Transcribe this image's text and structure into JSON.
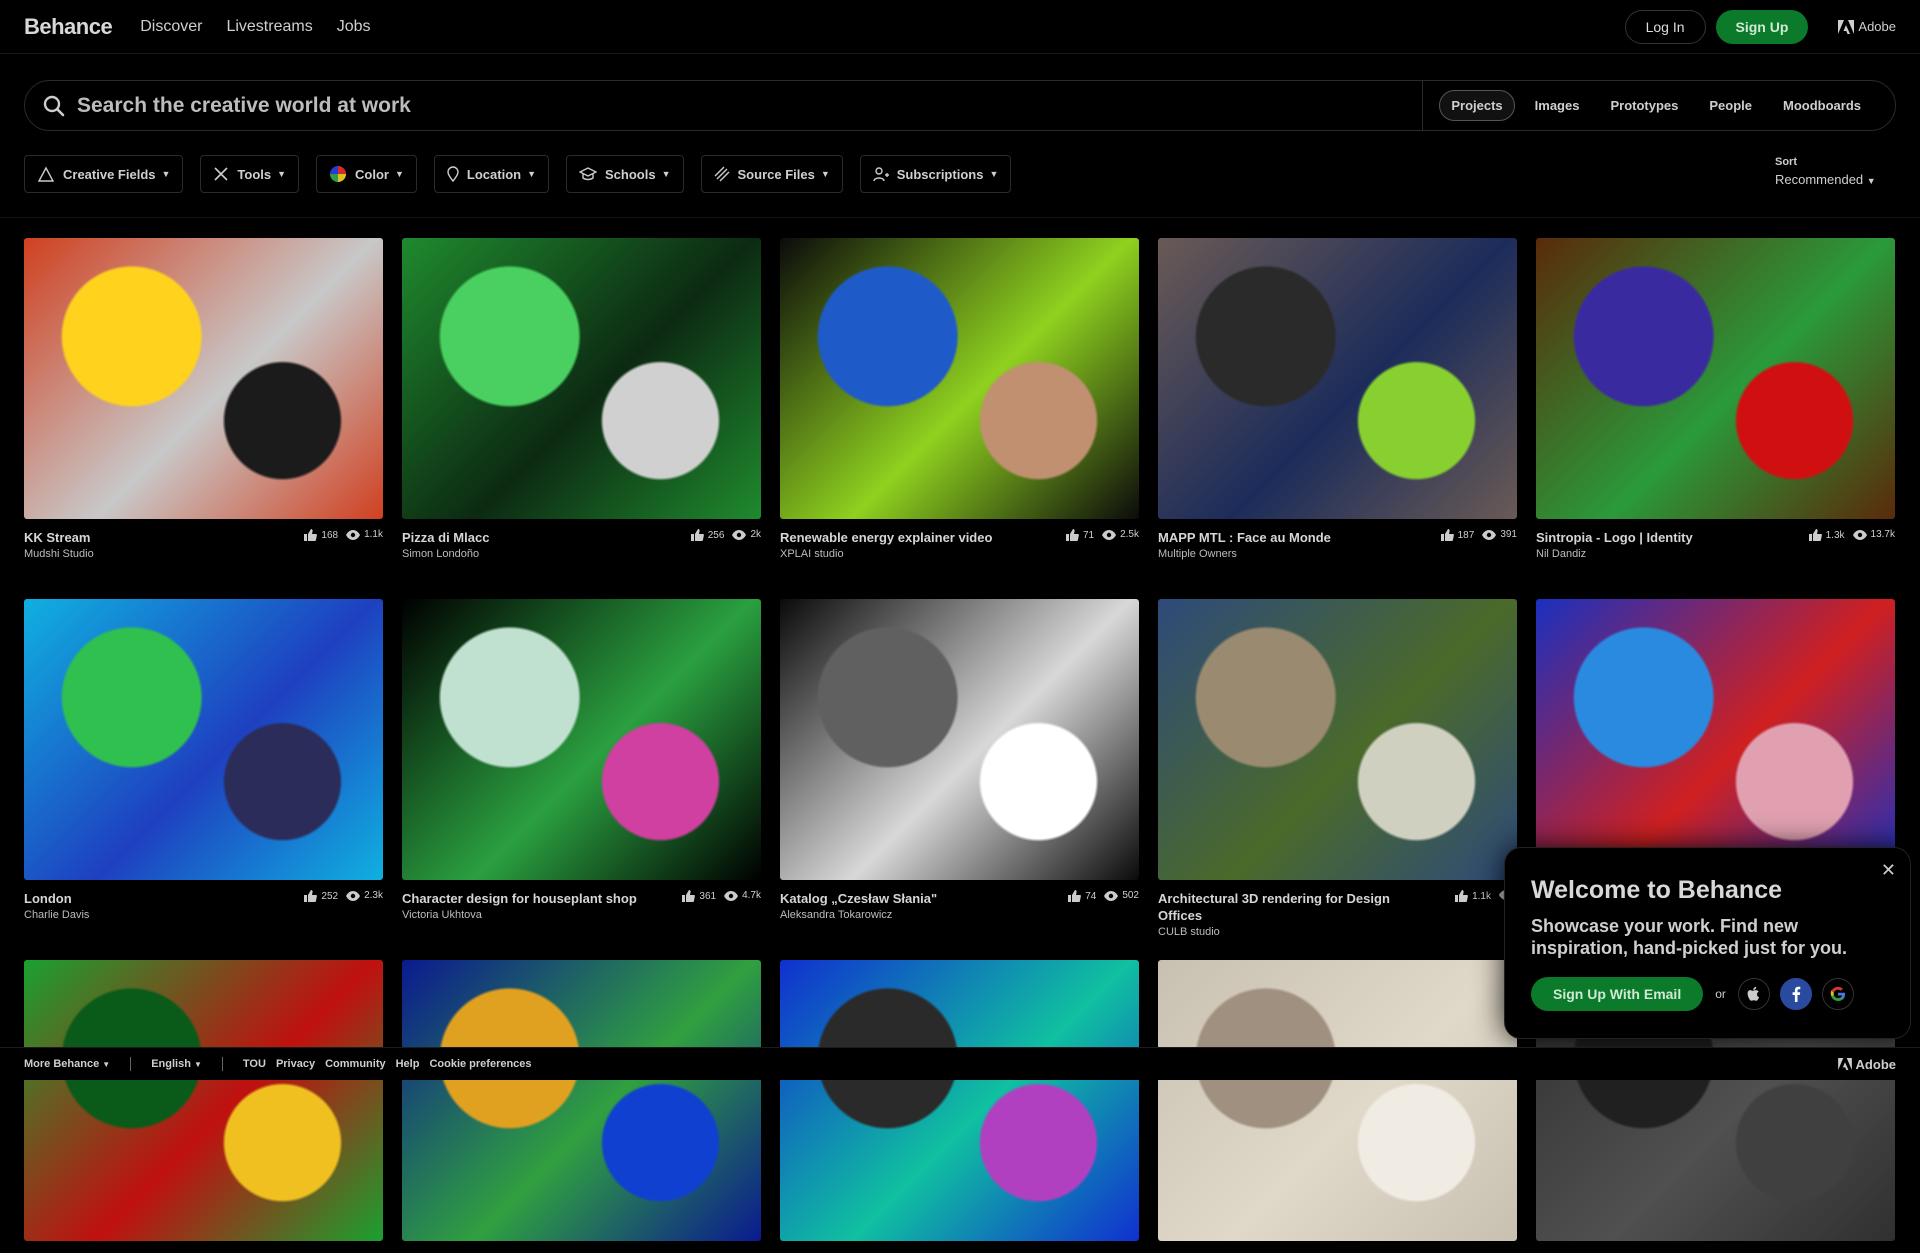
{
  "nav": {
    "logo": "Behance",
    "links": [
      "Discover",
      "Livestreams",
      "Jobs"
    ],
    "login": "Log In",
    "signup": "Sign Up",
    "adobe": "Adobe"
  },
  "search": {
    "placeholder": "Search the creative world at work",
    "tabs": [
      "Projects",
      "Images",
      "Prototypes",
      "People",
      "Moodboards"
    ],
    "active_tab": "Projects"
  },
  "filters": [
    "Creative Fields",
    "Tools",
    "Color",
    "Location",
    "Schools",
    "Source Files",
    "Subscriptions"
  ],
  "sort": {
    "label": "Sort",
    "value": "Recommended"
  },
  "projects": [
    {
      "title": "KK Stream",
      "owner": "Mudshi Studio",
      "likes": "168",
      "views": "1.1k",
      "colors": [
        "#d04020",
        "#c8c8c8",
        "#ffd21e",
        "#1b1b1b"
      ]
    },
    {
      "title": "Pizza di Mlacc",
      "owner": "Simon Londoño",
      "likes": "256",
      "views": "2k",
      "colors": [
        "#1f8a2e",
        "#0c2a12",
        "#49d060",
        "#d0d0d0"
      ]
    },
    {
      "title": "Renewable energy explainer video",
      "owner": "XPLAI studio",
      "likes": "71",
      "views": "2.5k",
      "colors": [
        "#0b0b0b",
        "#8fd11f",
        "#1e5bc8",
        "#c09070"
      ]
    },
    {
      "title": "MAPP MTL : Face au Monde",
      "owner": "Multiple Owners",
      "likes": "187",
      "views": "391",
      "colors": [
        "#6a5a55",
        "#1c2c5a",
        "#2a2a2a",
        "#88d030"
      ]
    },
    {
      "title": "Sintropia - Logo | Identity",
      "owner": "Nil Dandiz",
      "likes": "1.3k",
      "views": "13.7k",
      "colors": [
        "#5a2a0a",
        "#2a9a3a",
        "#3a2aa0",
        "#d01010"
      ]
    },
    {
      "title": "London",
      "owner": "Charlie Davis",
      "likes": "252",
      "views": "2.3k",
      "colors": [
        "#10b0e0",
        "#1e40c0",
        "#30c050",
        "#2c2c5a"
      ]
    },
    {
      "title": "Character design for houseplant shop",
      "owner": "Victoria Ukhtova",
      "likes": "361",
      "views": "4.7k",
      "colors": [
        "#000000",
        "#2aa040",
        "#c0e0d0",
        "#d040a0"
      ]
    },
    {
      "title": "Katalog „Czesław Słania\"",
      "owner": "Aleksandra Tokarowicz",
      "likes": "74",
      "views": "502",
      "colors": [
        "#0a0a0a",
        "#d8d8d8",
        "#606060",
        "#ffffff"
      ]
    },
    {
      "title": "Architectural 3D rendering for Design Offices",
      "owner": "CULB studio",
      "likes": "1.1k",
      "views": "",
      "colors": [
        "#2e4a7a",
        "#4a6a2a",
        "#9a8a70",
        "#d0d0c0"
      ]
    },
    {
      "title": "",
      "owner": "",
      "likes": "",
      "views": "",
      "colors": [
        "#1a30c0",
        "#d02020",
        "#2a8ae0",
        "#e0a0b0"
      ]
    },
    {
      "title": "",
      "owner": "",
      "likes": "",
      "views": "",
      "colors": [
        "#1aa030",
        "#c01010",
        "#0a5a1a",
        "#f0c020"
      ]
    },
    {
      "title": "",
      "owner": "",
      "likes": "",
      "views": "",
      "colors": [
        "#0a1a90",
        "#30a040",
        "#e0a020",
        "#1040d0"
      ]
    },
    {
      "title": "",
      "owner": "",
      "likes": "",
      "views": "",
      "colors": [
        "#1030d0",
        "#10c0a0",
        "#2a2a2a",
        "#b040c0"
      ]
    },
    {
      "title": "",
      "owner": "",
      "likes": "",
      "views": "",
      "colors": [
        "#c8c0b0",
        "#e0d8c8",
        "#a09080",
        "#f0ece4"
      ]
    },
    {
      "title": "",
      "owner": "",
      "likes": "",
      "views": "",
      "colors": [
        "#303030",
        "#505050",
        "#202020",
        "#404040"
      ]
    }
  ],
  "welcome": {
    "title": "Welcome to Behance",
    "text": "Showcase your work. Find new inspiration, hand-picked just for you.",
    "signup_email": "Sign Up With Email",
    "or": "or"
  },
  "footer": {
    "more": "More Behance",
    "language": "English",
    "links": [
      "TOU",
      "Privacy",
      "Community",
      "Help",
      "Cookie preferences"
    ],
    "adobe": "Adobe"
  },
  "colors": {
    "accent": "#0b7a2a",
    "background": "#000000"
  }
}
